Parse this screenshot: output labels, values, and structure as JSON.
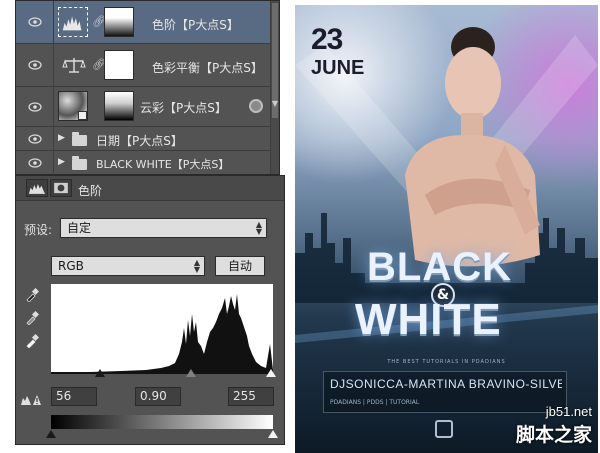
{
  "layers": [
    {
      "name": "色阶【P大点S】",
      "type": "adjustment",
      "selected": true
    },
    {
      "name": "色彩平衡【P大点S】",
      "type": "adjustment",
      "selected": false
    },
    {
      "name": "云彩【P大点S】",
      "type": "smart",
      "selected": false
    },
    {
      "name": "日期【P大点S】",
      "type": "group",
      "selected": false
    },
    {
      "name": "BLACK WHITE【P大点S】",
      "type": "group",
      "selected": false
    }
  ],
  "properties": {
    "title": "色阶",
    "preset_label": "预设:",
    "preset_value": "自定",
    "channel_value": "RGB",
    "auto_button": "自动",
    "input_black": "56",
    "input_gamma": "0.90",
    "input_white": "255"
  },
  "poster": {
    "date_day": "23",
    "date_month": "JUNE",
    "title_line1": "BLACK",
    "amp": "&",
    "title_line2": "WHITE",
    "tagline": "THE BEST TUTORIALS IN PDADIANS",
    "djs_line": "DJSONICCA-MARTINA BRAVINO-SILVER SUNSET",
    "djs_sub": "PDADIANS | PDDS | TUTORIAL"
  },
  "watermark": {
    "url": "jb51.net",
    "cn": "脚本之家"
  },
  "colors": {
    "panel_bg": "#535353",
    "selected_layer": "#596a83",
    "poster_accent": "#d078dc"
  }
}
